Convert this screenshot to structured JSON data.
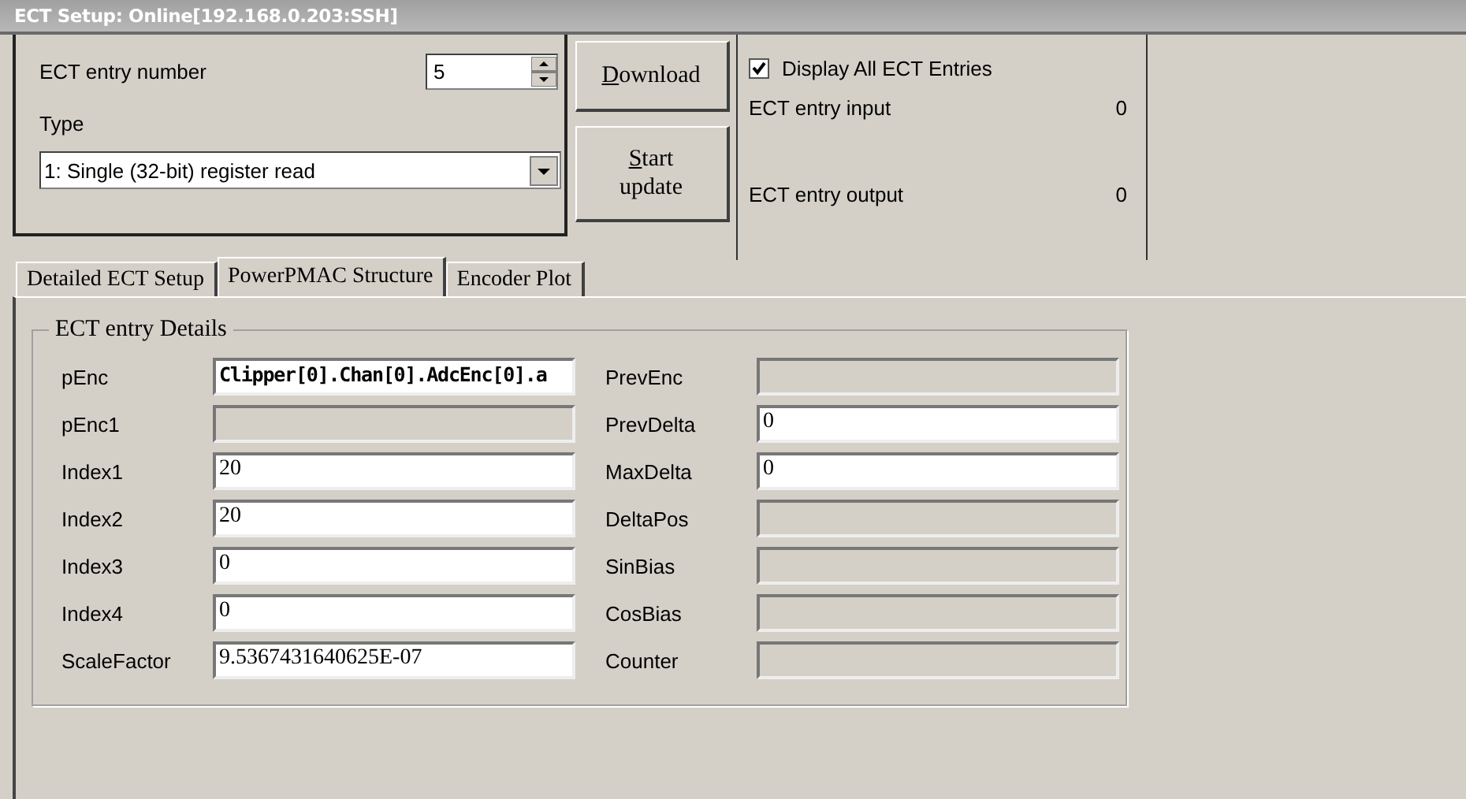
{
  "window": {
    "title": "ECT Setup: Online[192.168.0.203:SSH]"
  },
  "entry": {
    "label": "ECT entry number",
    "value": "5"
  },
  "type": {
    "label": "Type",
    "value": "1: Single (32-bit) register read"
  },
  "buttons": [
    {
      "label": "Download"
    },
    {
      "label": "Start update"
    }
  ],
  "display_all": {
    "label": "Display All ECT Entries",
    "checked": true
  },
  "readouts": [
    {
      "label": "ECT entry input",
      "value": "0"
    },
    {
      "label": "ECT entry output",
      "value": "0"
    }
  ],
  "tabs": [
    {
      "label": "Detailed ECT Setup",
      "selected": false
    },
    {
      "label": "PowerPMAC Structure",
      "selected": true
    },
    {
      "label": "Encoder Plot",
      "selected": false
    }
  ],
  "group": {
    "title": "ECT entry Details"
  },
  "left_fields": [
    {
      "label": "pEnc",
      "value": "Clipper[0].Chan[0].AdcEnc[0].a",
      "editable": true,
      "bold": true
    },
    {
      "label": "pEnc1",
      "editable": false
    },
    {
      "label": "Index1",
      "value": "20",
      "editable": true,
      "bold": false
    },
    {
      "label": "Index2",
      "value": "20",
      "editable": true,
      "bold": false
    },
    {
      "label": "Index3",
      "value": "0",
      "editable": true,
      "bold": false
    },
    {
      "label": "Index4",
      "value": "0",
      "editable": true,
      "bold": false
    },
    {
      "label": "ScaleFactor",
      "value": "9.5367431640625E-07",
      "editable": true,
      "bold": false
    }
  ],
  "right_fields": [
    {
      "label": "PrevEnc",
      "editable": false
    },
    {
      "label": "PrevDelta",
      "value": "0",
      "editable": true,
      "bold": false
    },
    {
      "label": "MaxDelta",
      "value": "0",
      "editable": true,
      "bold": false
    },
    {
      "label": "DeltaPos",
      "editable": false
    },
    {
      "label": "SinBias",
      "editable": false
    },
    {
      "label": "CosBias",
      "editable": false
    },
    {
      "label": "Counter",
      "editable": false
    }
  ]
}
